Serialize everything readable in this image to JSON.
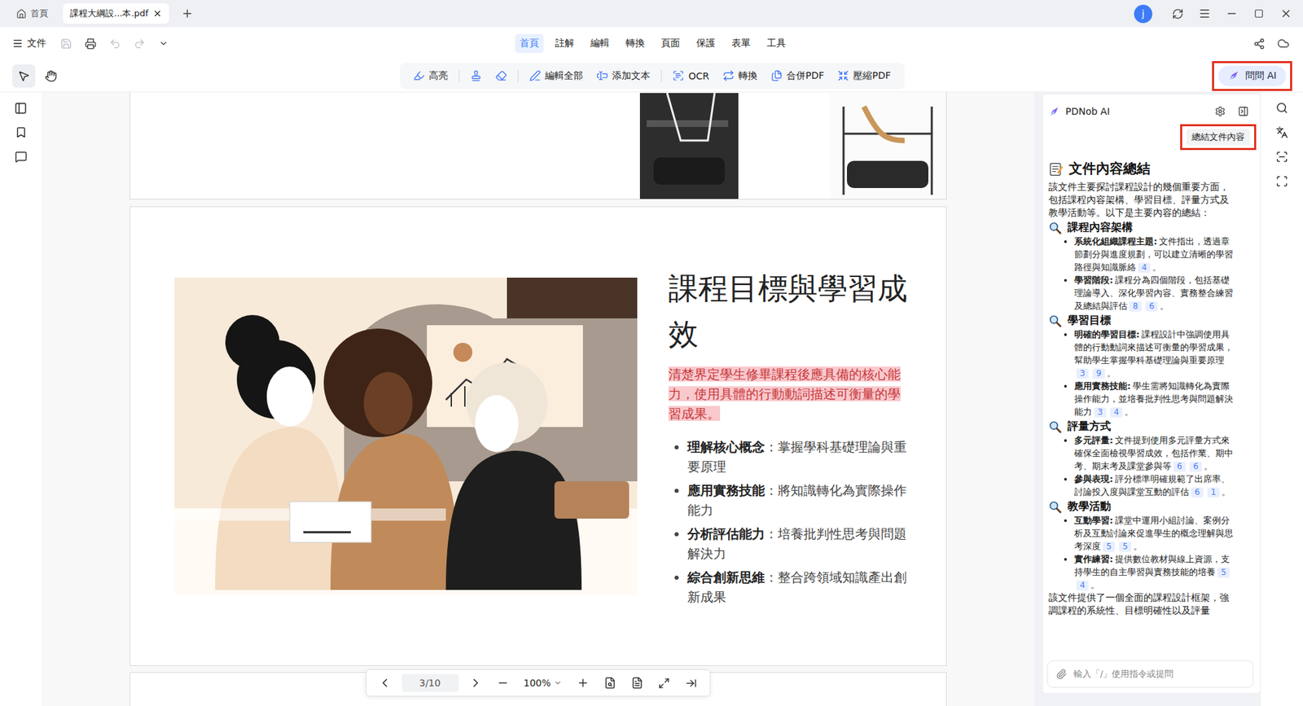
{
  "titlebar": {
    "tabs": [
      {
        "label": "首頁",
        "kind": "home",
        "selected": false
      },
      {
        "label": "課程大綱設...本.pdf",
        "kind": "file",
        "selected": true
      }
    ],
    "avatar": "j"
  },
  "menubar": {
    "file": "文件",
    "quick": [
      {
        "kind": "save",
        "disabled": true
      },
      {
        "kind": "print",
        "disabled": false
      },
      {
        "kind": "undo",
        "disabled": true
      },
      {
        "kind": "redo",
        "disabled": true
      },
      {
        "kind": "more",
        "disabled": false
      }
    ],
    "menus": [
      {
        "label": "首頁",
        "selected": true
      },
      {
        "label": "註解",
        "selected": false
      },
      {
        "label": "編輯",
        "selected": false
      },
      {
        "label": "轉換",
        "selected": false
      },
      {
        "label": "頁面",
        "selected": false
      },
      {
        "label": "保護",
        "selected": false
      },
      {
        "label": "表單",
        "selected": false
      },
      {
        "label": "工具",
        "selected": false
      }
    ]
  },
  "toolbar": {
    "tools": [
      {
        "kind": "select",
        "selected": true
      },
      {
        "kind": "hand",
        "selected": false
      }
    ],
    "actions": [
      {
        "kind": "highlight",
        "label": "高亮"
      },
      {
        "kind": "separator"
      },
      {
        "kind": "stamp"
      },
      {
        "kind": "eraser"
      },
      {
        "kind": "separator"
      },
      {
        "kind": "edit",
        "label": "編輯全部"
      },
      {
        "kind": "addtext",
        "label": "添加文本"
      },
      {
        "kind": "separator"
      },
      {
        "kind": "ocr",
        "label": "OCR"
      },
      {
        "kind": "convert",
        "label": "轉換"
      },
      {
        "kind": "merge",
        "label": "合併PDF"
      },
      {
        "kind": "compress",
        "label": "壓縮PDF"
      }
    ],
    "ask_ai": {
      "label": "問問 AI",
      "annotated": true
    }
  },
  "document": {
    "page": {
      "title": "課程目標與學習成效",
      "lead": {
        "text": "清楚界定學生修畢課程後應具備的核心能力，使用具體的行動動詞描述可衡量的學習成果。",
        "highlighted": true
      },
      "bullets": [
        {
          "label": "理解核心概念",
          "text": "：掌握學科基礎理論與重要原理"
        },
        {
          "label": "應用實務技能",
          "text": "：將知識轉化為實際操作能力"
        },
        {
          "label": "分析評估能力",
          "text": "：培養批判性思考與問題解決力"
        },
        {
          "label": "綜合創新思維",
          "text": "：整合跨領域知識產出創新成果"
        }
      ]
    },
    "pager": {
      "page": "3/10",
      "zoom": "100%"
    }
  },
  "ai_panel": {
    "title": "PDNob AI",
    "summary_button": {
      "label": "總結文件內容",
      "annotated": true
    },
    "heading": "文件內容總結",
    "intro": "該文件主要探討課程設計的幾個重要方面，包括課程內容架構、學習目標、評量方式及教學活動等。以下是主要內容的總結：",
    "sections": [
      {
        "title": "課程內容架構",
        "items": [
          {
            "label": "系統化組織課程主題:",
            "text": "文件指出，透過章節劃分與進度規劃，可以建立清晰的學習路徑與知識脈絡",
            "cites": [
              "4"
            ],
            "end": "。"
          },
          {
            "label": "學習階段:",
            "text": "課程分為四個階段，包括基礎理論導入、深化學習內容、實務整合練習及總結與評估",
            "cites": [
              "8",
              "6"
            ],
            "end": "。"
          }
        ]
      },
      {
        "title": "學習目標",
        "items": [
          {
            "label": "明確的學習目標:",
            "text": "課程設計中強調使用具體的行動動詞來描述可衡量的學習成果，幫助學生掌握學科基礎理論與重要原理",
            "cites": [
              "3",
              "9"
            ],
            "end": "。"
          },
          {
            "label": "應用實務技能:",
            "text": "學生需將知識轉化為實際操作能力，並培養批判性思考與問題解決能力",
            "cites": [
              "3",
              "4"
            ],
            "end": "。"
          }
        ]
      },
      {
        "title": "評量方式",
        "items": [
          {
            "label": "多元評量:",
            "text": "文件提到使用多元評量方式來確保全面檢視學習成效，包括作業、期中考、期末考及課堂參與等",
            "cites": [
              "6",
              "6"
            ],
            "end": "。"
          },
          {
            "label": "參與表現:",
            "text": "評分標準明確規範了出席率、討論投入度與課堂互動的評估",
            "cites": [
              "6",
              "1"
            ],
            "end": "。"
          }
        ]
      },
      {
        "title": "教學活動",
        "items": [
          {
            "label": "互動學習:",
            "text": "課堂中運用小組討論、案例分析及互動討論來促進學生的概念理解與思考深度",
            "cites": [
              "5",
              "5"
            ],
            "end": "。"
          },
          {
            "label": "實作練習:",
            "text": "提供數位教材與線上資源，支持學生的自主學習與實務技能的培養",
            "cites": [
              "5",
              "4"
            ],
            "end": "。"
          }
        ]
      }
    ],
    "conclusion": "該文件提供了一個全面的課程設計框架，強調課程的系統性、目標明確性以及評量",
    "input_placeholder": "輸入「/」使用指令或提問"
  }
}
